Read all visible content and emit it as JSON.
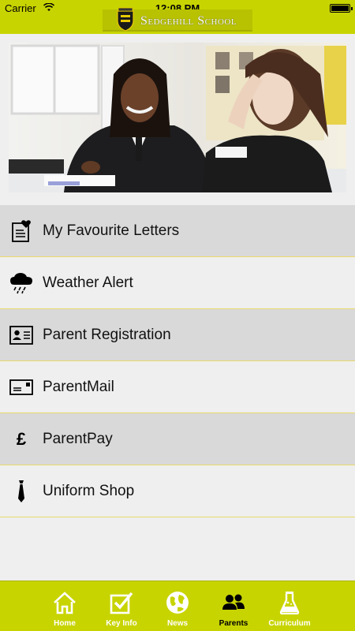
{
  "status_bar": {
    "carrier": "Carrier",
    "time": "12:08 PM"
  },
  "header": {
    "logo_text": "Sedgehill School"
  },
  "menu": [
    {
      "label": "My Favourite Letters",
      "icon": "letter-heart-icon"
    },
    {
      "label": "Weather Alert",
      "icon": "rain-cloud-icon"
    },
    {
      "label": "Parent Registration",
      "icon": "id-card-icon"
    },
    {
      "label": "ParentMail",
      "icon": "mail-icon"
    },
    {
      "label": "ParentPay",
      "icon": "pound-icon",
      "glyph": "£"
    },
    {
      "label": "Uniform Shop",
      "icon": "tie-icon"
    }
  ],
  "tabs": [
    {
      "label": "Home",
      "icon": "home-icon",
      "active": false
    },
    {
      "label": "Key Info",
      "icon": "checkbox-icon",
      "active": false
    },
    {
      "label": "News",
      "icon": "globe-icon",
      "active": false
    },
    {
      "label": "Parents",
      "icon": "people-icon",
      "active": true
    },
    {
      "label": "Curriculum",
      "icon": "flask-icon",
      "active": false
    }
  ],
  "colors": {
    "accent": "#c8d400",
    "row_dark": "#d9d9d9",
    "row_light": "#efefef",
    "divider": "#e9d96a"
  }
}
